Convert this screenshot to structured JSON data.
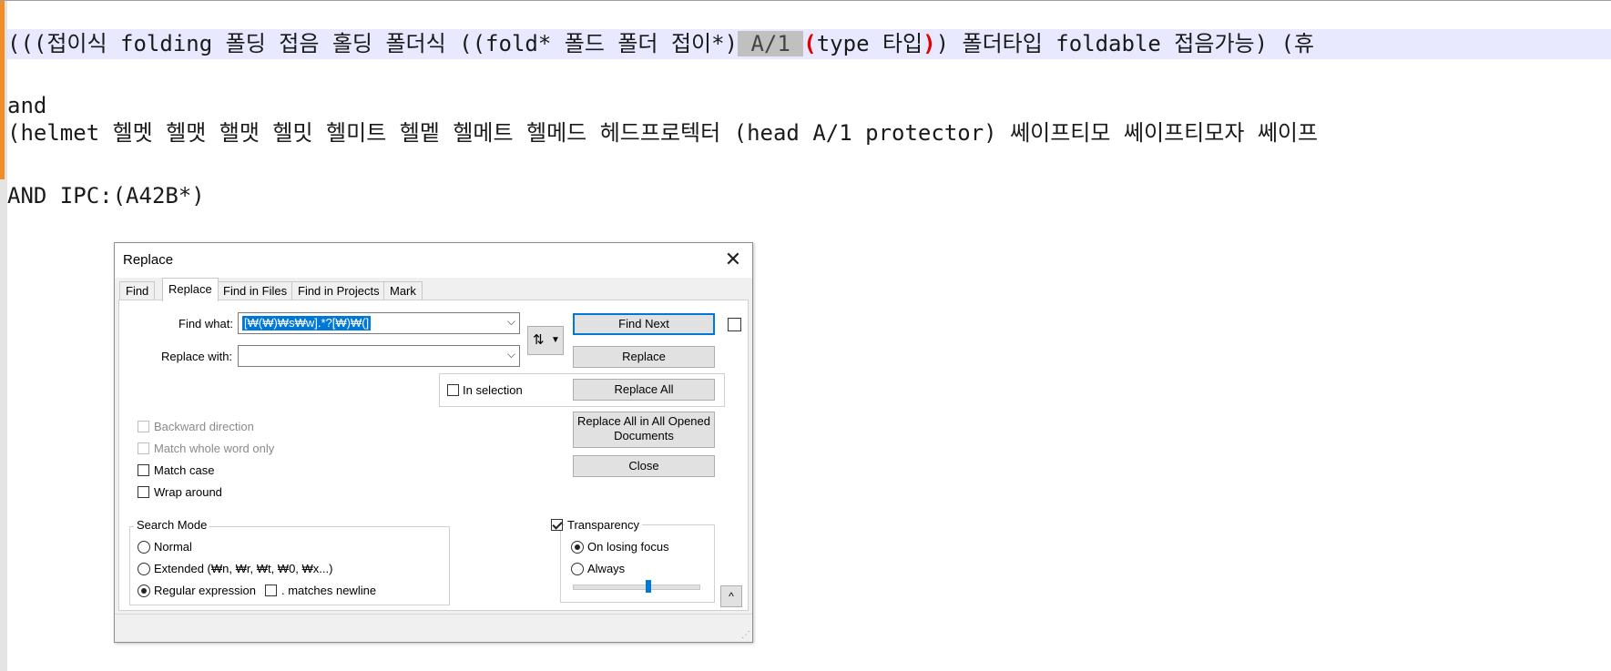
{
  "editor": {
    "line1": {
      "pre": "(((접이식 folding 폴딩 접음 홀딩 폴더식 ((fold* 폴드 폴더 접이*)",
      "selected": " A/1 ",
      "paren_open": "(",
      "mid": "type 타입",
      "paren_close": ")",
      "post": ") 폴더타입 foldable 접음가능) (휴"
    },
    "line2": "and",
    "line3": "(helmet 헬멧 헬맷 핼맷 헬밋 헬미트 헬멭 헬메트 헬메드 헤드프로텍터 (head A/1 protector) 쎄이프티모 쎄이프티모자 쎄이프",
    "line4": "AND IPC:(A42B*)"
  },
  "dialog": {
    "title": "Replace",
    "tabs": [
      "Find",
      "Replace",
      "Find in Files",
      "Find in Projects",
      "Mark"
    ],
    "active_tab": "Replace",
    "find_what_label": "Find what:",
    "find_what_value": "[₩(₩)₩s₩w].*?[₩)₩(]",
    "replace_with_label": "Replace with:",
    "replace_with_value": "",
    "swap_icon_label": "⇅",
    "buttons": {
      "find_next": "Find Next",
      "replace": "Replace",
      "replace_all": "Replace All",
      "replace_all_opened": "Replace All in All Opened Documents",
      "close": "Close",
      "expand": "^"
    },
    "in_selection": "In selection",
    "options": {
      "backward": "Backward direction",
      "whole_word": "Match whole word only",
      "match_case": "Match case",
      "wrap_around": "Wrap around"
    },
    "search_mode": {
      "title": "Search Mode",
      "normal": "Normal",
      "extended": "Extended (₩n, ₩r, ₩t, ₩0, ₩x...)",
      "regex": "Regular expression",
      "matches_newline": ". matches newline",
      "selected": "Regular expression"
    },
    "transparency": {
      "title": "Transparency",
      "checked": true,
      "on_losing_focus": "On losing focus",
      "always": "Always",
      "selected": "On losing focus",
      "level": 0.6
    }
  }
}
